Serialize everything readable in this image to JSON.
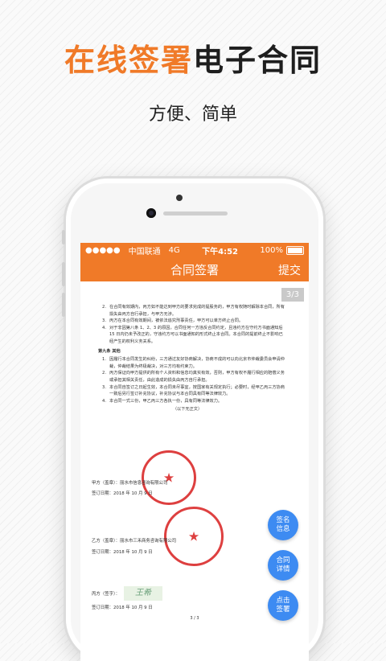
{
  "headline": {
    "orange_part": "在线签署",
    "dark_part": "电子合同"
  },
  "subline": "方便、简单",
  "status_bar": {
    "carrier": "中国联通",
    "network": "4G",
    "time": "下午4:52",
    "battery": "100%"
  },
  "navbar": {
    "title": "合同签署",
    "submit_label": "提交"
  },
  "page_badge": "3/3",
  "document": {
    "clauses_top": [
      {
        "num": "2.",
        "text": "在合同有效期内，丙方如不能达到甲方的要求完成的提股务的，甲方有权随时解除本合同，所有损失由丙方自行承担，与甲方无涉。"
      },
      {
        "num": "3.",
        "text": "丙方在本合同有效期间，被依法追究刑事责任，甲方可以单方终止合同。"
      },
      {
        "num": "4.",
        "text": "对于非因第八条 1、2、3 的原因，合同任何一方违反合同约定，且违约方在守约方书面通知后 15 日内仍未予改正的，守违约方可以书面通知的形式终止本合同。本合同的提前终止不影响已经产生的权利义务关系。"
      }
    ],
    "section_title": "第九条  其他",
    "clauses_bottom": [
      {
        "num": "1.",
        "text": "因履行本合同发生的纠纷，三方通过友好协商解决，协商不成的可以向北京市仲裁委员会申请仲裁，仲裁结果为终极裁决，对三方均有约束力。"
      },
      {
        "num": "2.",
        "text": "丙方保证向甲方提供的所有个人资料和信息均真实有效，否则，甲方有权不履行相应的赔偿义务或承担其相关责任，由此造成的损失由丙方自行承担。"
      },
      {
        "num": "3.",
        "text": "本合同自签订之日起生效，本合同未尽事宜，按国家有关规定执行；必要时，经甲乙丙三方协商一致后另行签订补充协议，补充协议与本合同具有同等法律效力。"
      },
      {
        "num": "4.",
        "text": "本合同一式三份，甲乙丙三方各执一份，具有同等法律效力。"
      }
    ],
    "end_note": "（以下无正文）",
    "party_a": {
      "label": "甲方（盖章）：丽水市信息咨询有限公司",
      "date": "签订日期：2018 年  10  月  9  日"
    },
    "party_b": {
      "label": "乙方（盖章）：丽水市三禾商务咨询有限公司",
      "date": "签订日期：2018 年  10  月  9  日"
    },
    "party_c": {
      "label": "丙方（签字）：",
      "signature": "王希",
      "date": "签订日期：2018 年  10  月  9  日"
    },
    "page_footer": "3 / 3"
  },
  "fabs": {
    "sign_info": "签名\n信息",
    "contract_detail": "合同\n详情",
    "click_sign": "点击\n签署"
  }
}
